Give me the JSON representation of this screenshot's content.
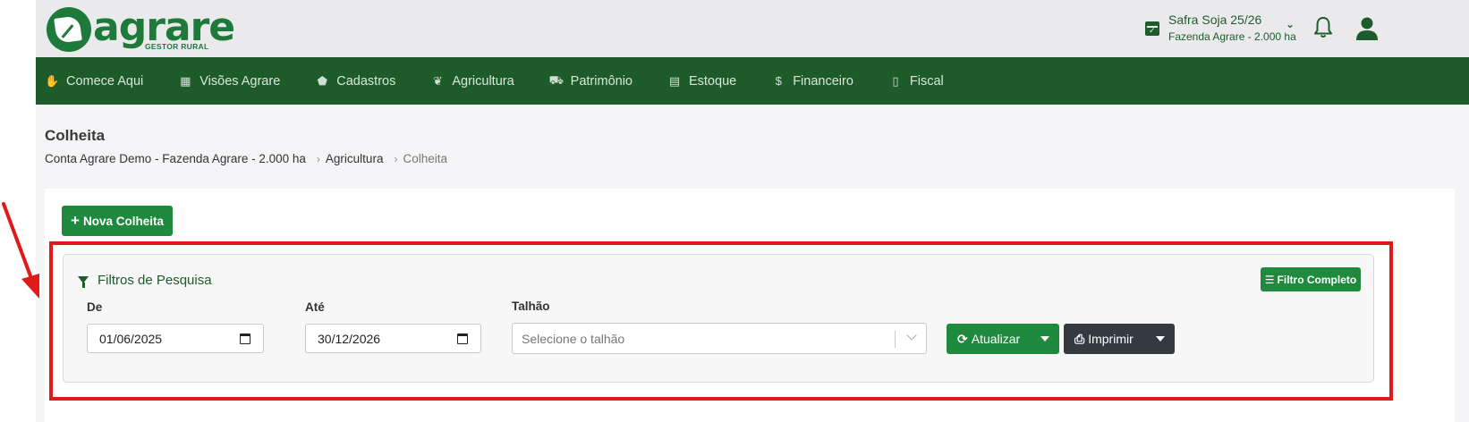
{
  "header": {
    "logo_word": "agrare",
    "logo_sub": "GESTOR RURAL",
    "safra_title": "Safra Soja 25/26",
    "safra_sub": "Fazenda Agrare - 2.000 ha"
  },
  "nav": {
    "items": [
      {
        "label": "Comece Aqui",
        "icon": "handshake-icon"
      },
      {
        "label": "Visões Agrare",
        "icon": "dashboard-icon"
      },
      {
        "label": "Cadastros",
        "icon": "tag-icon"
      },
      {
        "label": "Agricultura",
        "icon": "leaf-icon"
      },
      {
        "label": "Patrimônio",
        "icon": "tractor-icon"
      },
      {
        "label": "Estoque",
        "icon": "boxes-icon"
      },
      {
        "label": "Financeiro",
        "icon": "hand-money-icon"
      },
      {
        "label": "Fiscal",
        "icon": "file-invoice-icon"
      }
    ]
  },
  "page": {
    "title": "Colheita",
    "breadcrumb": [
      "Conta Agrare Demo - Fazenda Agrare - 2.000 ha",
      "Agricultura",
      "Colheita"
    ]
  },
  "actions": {
    "nova_colheita": "Nova Colheita"
  },
  "filters": {
    "title": "Filtros de Pesquisa",
    "filtro_completo": "Filtro Completo",
    "de_label": "De",
    "de_value": "01/06/2025",
    "ate_label": "Até",
    "ate_value": "30/12/2026",
    "talhao_label": "Talhão",
    "talhao_placeholder": "Selecione o talhão",
    "atualizar": "Atualizar",
    "imprimir": "Imprimir"
  },
  "colors": {
    "brand_green": "#1e5b2a",
    "button_green": "#1f8a3e",
    "dark_button": "#343a40",
    "highlight_red": "#e01a1a"
  }
}
